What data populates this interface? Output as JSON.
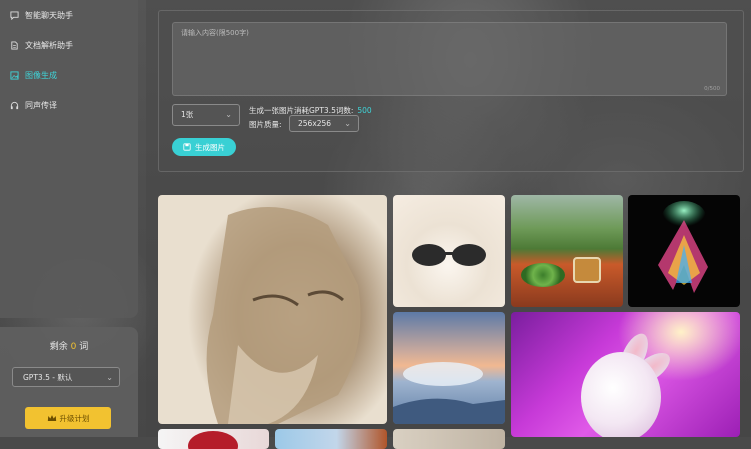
{
  "sidebar": {
    "nav": [
      {
        "label": "智能聊天助手",
        "icon": "chat-icon"
      },
      {
        "label": "文档解析助手",
        "icon": "document-icon"
      },
      {
        "label": "图像生成",
        "icon": "image-icon",
        "active": true
      },
      {
        "label": "同声传译",
        "icon": "headphones-icon"
      }
    ],
    "remain_prefix": "剩余",
    "remain_count": "0",
    "remain_suffix": "词",
    "model_value": "GPT3.5 - 默认",
    "upgrade_label": "升级计划"
  },
  "generator": {
    "prompt_placeholder": "请输入内容(限500字)",
    "char_counter": "0/500",
    "quantity_value": "1张",
    "cost_label": "生成一张图片消耗GPT3.5词数:",
    "cost_value": "500",
    "quality_label": "图片质量:",
    "quality_value": "256x256",
    "generate_label": "生成图片"
  },
  "gallery": {
    "images": [
      "sculpture-face",
      "cat-sunglasses",
      "tea-green-coil",
      "color-powder-burst",
      "sea-of-clouds",
      "pink-bunny",
      "red-circle",
      "sky-rock",
      "building"
    ]
  },
  "colors": {
    "accent": "#3fd4d8",
    "gold": "#f2c230"
  }
}
